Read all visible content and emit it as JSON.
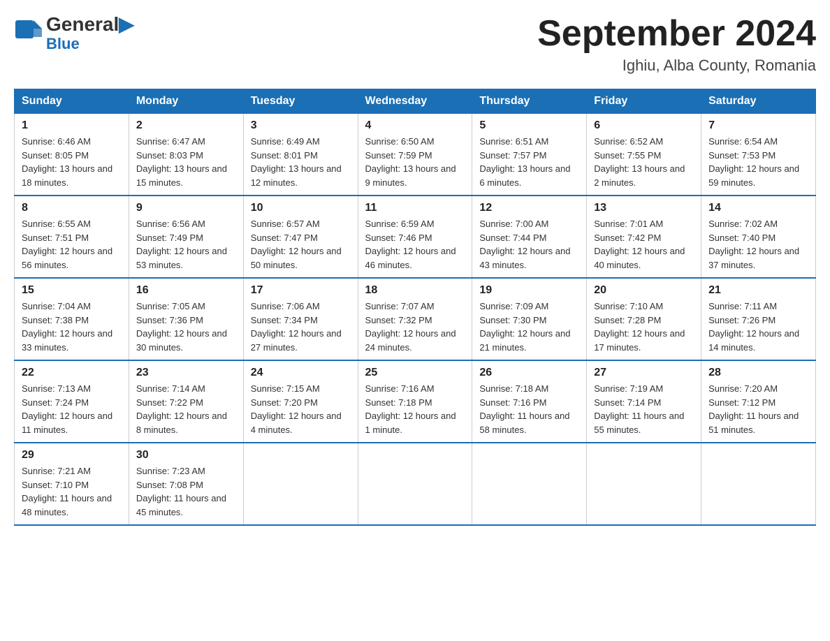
{
  "logo": {
    "general": "General",
    "blue": "Blue"
  },
  "title": "September 2024",
  "subtitle": "Ighiu, Alba County, Romania",
  "weekdays": [
    "Sunday",
    "Monday",
    "Tuesday",
    "Wednesday",
    "Thursday",
    "Friday",
    "Saturday"
  ],
  "weeks": [
    [
      {
        "day": "1",
        "sunrise": "6:46 AM",
        "sunset": "8:05 PM",
        "daylight": "13 hours and 18 minutes."
      },
      {
        "day": "2",
        "sunrise": "6:47 AM",
        "sunset": "8:03 PM",
        "daylight": "13 hours and 15 minutes."
      },
      {
        "day": "3",
        "sunrise": "6:49 AM",
        "sunset": "8:01 PM",
        "daylight": "13 hours and 12 minutes."
      },
      {
        "day": "4",
        "sunrise": "6:50 AM",
        "sunset": "7:59 PM",
        "daylight": "13 hours and 9 minutes."
      },
      {
        "day": "5",
        "sunrise": "6:51 AM",
        "sunset": "7:57 PM",
        "daylight": "13 hours and 6 minutes."
      },
      {
        "day": "6",
        "sunrise": "6:52 AM",
        "sunset": "7:55 PM",
        "daylight": "13 hours and 2 minutes."
      },
      {
        "day": "7",
        "sunrise": "6:54 AM",
        "sunset": "7:53 PM",
        "daylight": "12 hours and 59 minutes."
      }
    ],
    [
      {
        "day": "8",
        "sunrise": "6:55 AM",
        "sunset": "7:51 PM",
        "daylight": "12 hours and 56 minutes."
      },
      {
        "day": "9",
        "sunrise": "6:56 AM",
        "sunset": "7:49 PM",
        "daylight": "12 hours and 53 minutes."
      },
      {
        "day": "10",
        "sunrise": "6:57 AM",
        "sunset": "7:47 PM",
        "daylight": "12 hours and 50 minutes."
      },
      {
        "day": "11",
        "sunrise": "6:59 AM",
        "sunset": "7:46 PM",
        "daylight": "12 hours and 46 minutes."
      },
      {
        "day": "12",
        "sunrise": "7:00 AM",
        "sunset": "7:44 PM",
        "daylight": "12 hours and 43 minutes."
      },
      {
        "day": "13",
        "sunrise": "7:01 AM",
        "sunset": "7:42 PM",
        "daylight": "12 hours and 40 minutes."
      },
      {
        "day": "14",
        "sunrise": "7:02 AM",
        "sunset": "7:40 PM",
        "daylight": "12 hours and 37 minutes."
      }
    ],
    [
      {
        "day": "15",
        "sunrise": "7:04 AM",
        "sunset": "7:38 PM",
        "daylight": "12 hours and 33 minutes."
      },
      {
        "day": "16",
        "sunrise": "7:05 AM",
        "sunset": "7:36 PM",
        "daylight": "12 hours and 30 minutes."
      },
      {
        "day": "17",
        "sunrise": "7:06 AM",
        "sunset": "7:34 PM",
        "daylight": "12 hours and 27 minutes."
      },
      {
        "day": "18",
        "sunrise": "7:07 AM",
        "sunset": "7:32 PM",
        "daylight": "12 hours and 24 minutes."
      },
      {
        "day": "19",
        "sunrise": "7:09 AM",
        "sunset": "7:30 PM",
        "daylight": "12 hours and 21 minutes."
      },
      {
        "day": "20",
        "sunrise": "7:10 AM",
        "sunset": "7:28 PM",
        "daylight": "12 hours and 17 minutes."
      },
      {
        "day": "21",
        "sunrise": "7:11 AM",
        "sunset": "7:26 PM",
        "daylight": "12 hours and 14 minutes."
      }
    ],
    [
      {
        "day": "22",
        "sunrise": "7:13 AM",
        "sunset": "7:24 PM",
        "daylight": "12 hours and 11 minutes."
      },
      {
        "day": "23",
        "sunrise": "7:14 AM",
        "sunset": "7:22 PM",
        "daylight": "12 hours and 8 minutes."
      },
      {
        "day": "24",
        "sunrise": "7:15 AM",
        "sunset": "7:20 PM",
        "daylight": "12 hours and 4 minutes."
      },
      {
        "day": "25",
        "sunrise": "7:16 AM",
        "sunset": "7:18 PM",
        "daylight": "12 hours and 1 minute."
      },
      {
        "day": "26",
        "sunrise": "7:18 AM",
        "sunset": "7:16 PM",
        "daylight": "11 hours and 58 minutes."
      },
      {
        "day": "27",
        "sunrise": "7:19 AM",
        "sunset": "7:14 PM",
        "daylight": "11 hours and 55 minutes."
      },
      {
        "day": "28",
        "sunrise": "7:20 AM",
        "sunset": "7:12 PM",
        "daylight": "11 hours and 51 minutes."
      }
    ],
    [
      {
        "day": "29",
        "sunrise": "7:21 AM",
        "sunset": "7:10 PM",
        "daylight": "11 hours and 48 minutes."
      },
      {
        "day": "30",
        "sunrise": "7:23 AM",
        "sunset": "7:08 PM",
        "daylight": "11 hours and 45 minutes."
      },
      null,
      null,
      null,
      null,
      null
    ]
  ],
  "labels": {
    "sunrise": "Sunrise:",
    "sunset": "Sunset:",
    "daylight": "Daylight:"
  }
}
